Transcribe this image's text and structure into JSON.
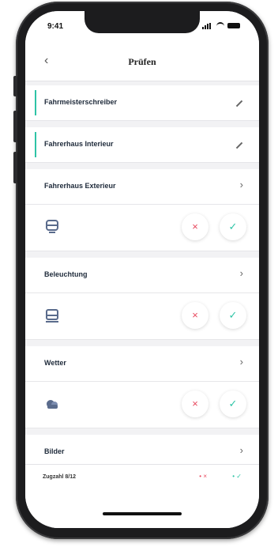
{
  "status": {
    "time": "9:41"
  },
  "nav": {
    "back_icon": "chevron-left-icon",
    "title": "Prüfen"
  },
  "rows": {
    "r1": {
      "label": "Fahrmeisterschreiber",
      "action_icon": "pencil-icon"
    },
    "r2": {
      "label": "Fahrerhaus Interieur",
      "action_icon": "pencil-icon"
    },
    "r3": {
      "label": "Fahrerhaus Exterieur",
      "action_icon": "chevron-right-icon",
      "item_icon": "train-icon"
    },
    "r4": {
      "label": "Beleuchtung",
      "action_icon": "chevron-right-icon",
      "item_icon": "train-front-icon"
    },
    "r5": {
      "label": "Wetter",
      "action_icon": "chevron-right-icon",
      "item_icon": "cloud-icon"
    },
    "r6": {
      "label": "Bilder",
      "action_icon": "chevron-right-icon"
    }
  },
  "buttons": {
    "reject": "×",
    "accept": "✓"
  },
  "footer": {
    "label": "Zugzahl 8/12",
    "reject": "• ×",
    "accept": "• ✓"
  },
  "colors": {
    "accent": "#2ec4a6",
    "reject": "#e84a5f",
    "background": "#f2f2f4"
  }
}
